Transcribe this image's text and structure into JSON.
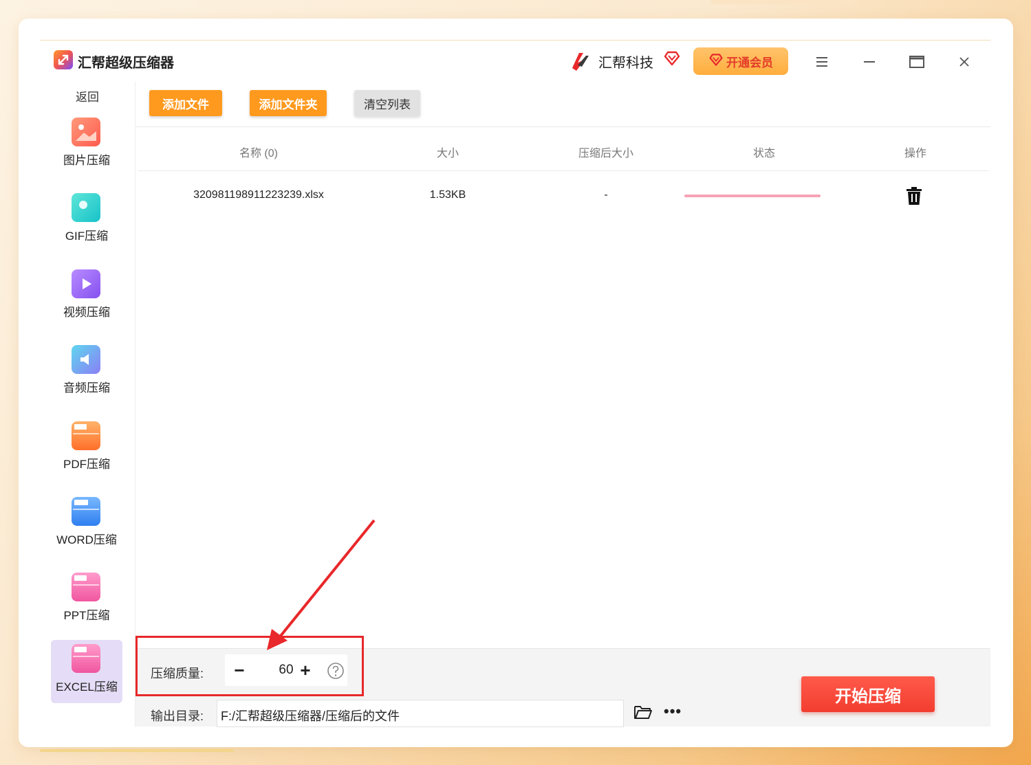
{
  "app": {
    "title": "汇帮超级压缩器",
    "brand_name": "汇帮科技",
    "vip_label": "开通会员"
  },
  "sidebar": {
    "back_label": "返回",
    "items": [
      {
        "label": "图片压缩",
        "icon": "image-icon",
        "color": "#ff6b5e"
      },
      {
        "label": "GIF压缩",
        "icon": "gif-icon",
        "color": "#2fd3c9"
      },
      {
        "label": "视频压缩",
        "icon": "video-icon",
        "color": "#9a62f7"
      },
      {
        "label": "音频压缩",
        "icon": "audio-icon",
        "color": "#47c0e8"
      },
      {
        "label": "PDF压缩",
        "icon": "pdf-icon",
        "color": "#ff8c3a"
      },
      {
        "label": "WORD压缩",
        "icon": "word-icon",
        "color": "#3a8ff5"
      },
      {
        "label": "PPT压缩",
        "icon": "ppt-icon",
        "color": "#f56ab0"
      },
      {
        "label": "EXCEL压缩",
        "icon": "excel-icon",
        "color": "#f56ab0"
      }
    ],
    "active_index": 7
  },
  "toolbar": {
    "add_file": "添加文件",
    "add_folder": "添加文件夹",
    "clear_list": "清空列表"
  },
  "table": {
    "headers": {
      "name": "名称 (0)",
      "size": "大小",
      "compressed_size": "压缩后大小",
      "status": "状态",
      "action": "操作"
    },
    "rows": [
      {
        "name": "320981198911223239.xlsx",
        "size": "1.53KB",
        "compressed_size": "-",
        "progress": 1.0
      }
    ]
  },
  "bottom": {
    "quality_label": "压缩质量:",
    "quality_value": "60",
    "minus": "−",
    "plus": "+",
    "output_label": "输出目录:",
    "output_path": "F:/汇帮超级压缩器/压缩后的文件",
    "start_button": "开始压缩",
    "more": "•••"
  },
  "colors": {
    "accent_orange": "#ff9a1f",
    "start_red": "#f23d30",
    "highlight_red": "#e8282a"
  }
}
